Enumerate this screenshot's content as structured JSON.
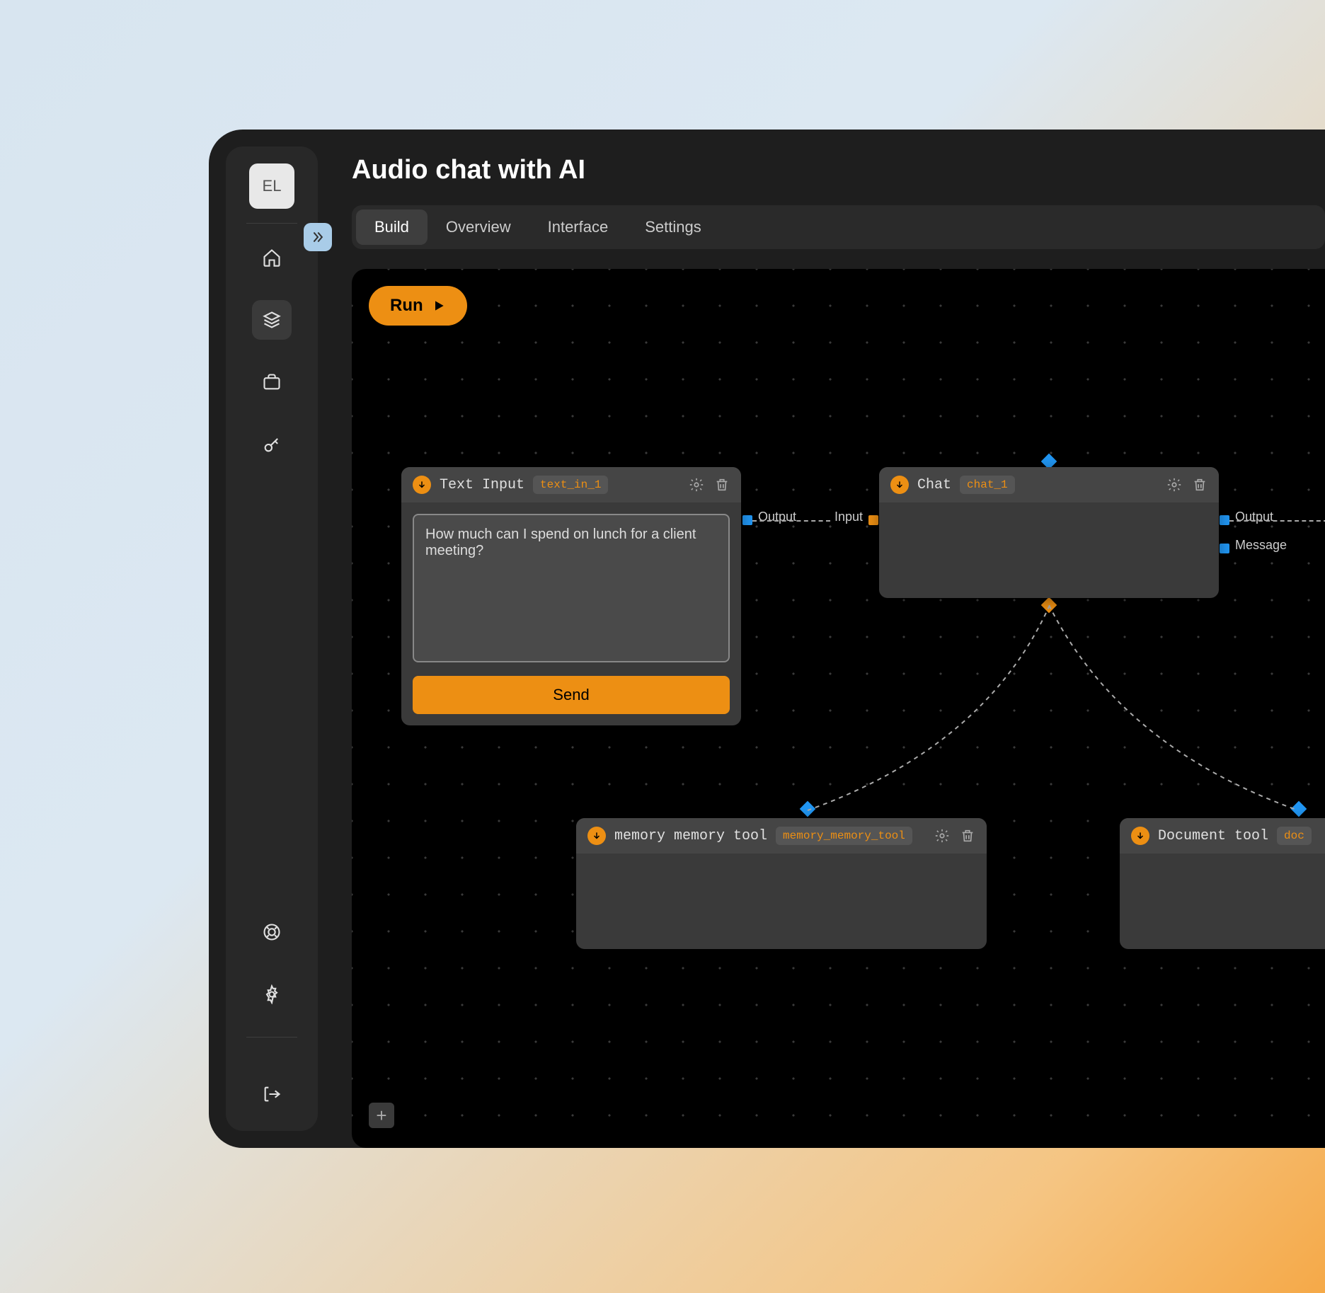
{
  "avatar_initials": "EL",
  "page_title": "Audio chat with AI",
  "tabs": [
    {
      "label": "Build",
      "active": true
    },
    {
      "label": "Overview",
      "active": false
    },
    {
      "label": "Interface",
      "active": false
    },
    {
      "label": "Settings",
      "active": false
    }
  ],
  "run_button": "Run",
  "nodes": {
    "text_input": {
      "title": "Text Input",
      "id": "text_in_1",
      "value": "How much can I spend on lunch for a client meeting?",
      "send_label": "Send",
      "output_port": "Output"
    },
    "chat": {
      "title": "Chat",
      "id": "chat_1",
      "input_port": "Input",
      "output_port": "Output",
      "message_port": "Message"
    },
    "memory": {
      "title": "memory memory tool",
      "id": "memory_memory_tool"
    },
    "document": {
      "title": "Document tool",
      "id": "doc"
    }
  },
  "colors": {
    "accent": "#ed8f13",
    "port_blue": "#2196f3"
  }
}
